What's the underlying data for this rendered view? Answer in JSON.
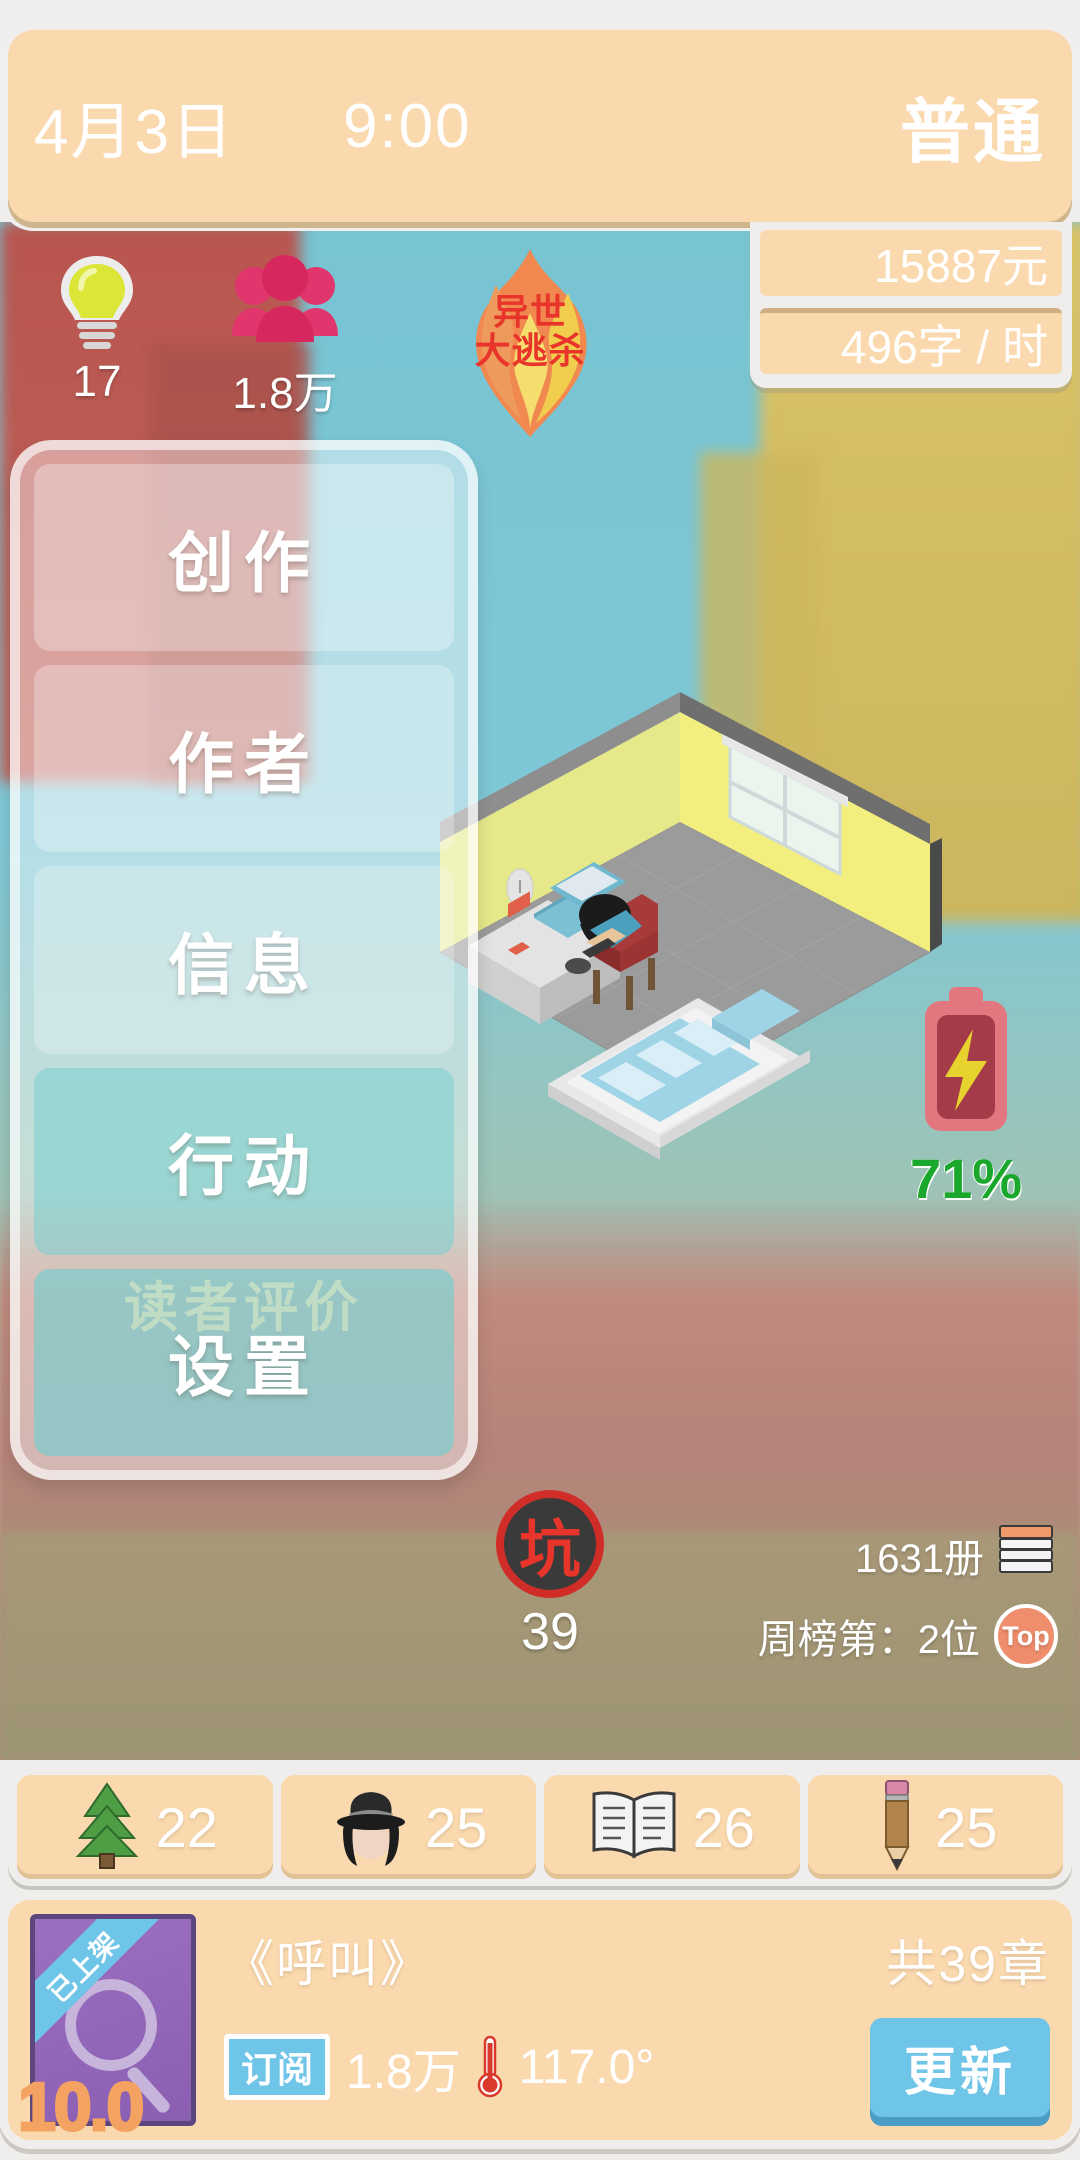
{
  "header": {
    "date": "4月3日",
    "time": "9:00",
    "difficulty": "普通"
  },
  "resources": {
    "money": "15887元",
    "speed": "496字 / 时"
  },
  "top_stats": [
    {
      "icon": "lightbulb-icon",
      "label": "inspiration",
      "value": "17"
    },
    {
      "icon": "fans-icon",
      "label": "fans",
      "value": "1.8万"
    }
  ],
  "trend": {
    "icon": "fire-icon",
    "line1": "异世",
    "line2": "大逃杀"
  },
  "menu": {
    "items": [
      {
        "label": "创作",
        "name": "menu-item-create"
      },
      {
        "label": "作者",
        "name": "menu-item-author"
      },
      {
        "label": "信息",
        "name": "menu-item-info"
      },
      {
        "label": "行动",
        "name": "menu-item-action"
      },
      {
        "label": "设置",
        "name": "menu-item-settings"
      }
    ],
    "ghost_label": "读者评价"
  },
  "battery": {
    "icon": "battery-icon",
    "percent": "71%",
    "color": "#19a72c"
  },
  "pit": {
    "badge": "坑",
    "count": "39"
  },
  "stats_right": {
    "books": "1631册",
    "books_icon": "book-stack-icon",
    "rank": "周榜第：2位",
    "rank_badge": "Top"
  },
  "skills": [
    {
      "icon": "tree-icon",
      "value": "22"
    },
    {
      "icon": "detective-hat-icon",
      "value": "25"
    },
    {
      "icon": "open-book-icon",
      "value": "26"
    },
    {
      "icon": "pencil-icon",
      "value": "25"
    }
  ],
  "book": {
    "ribbon": "已上架",
    "rating": "10.0",
    "title": "《呼叫》",
    "chapters": "共39章",
    "subscribe_label": "订阅",
    "subscribe_count": "1.8万",
    "heat": "117.0°",
    "update_label": "更新"
  }
}
